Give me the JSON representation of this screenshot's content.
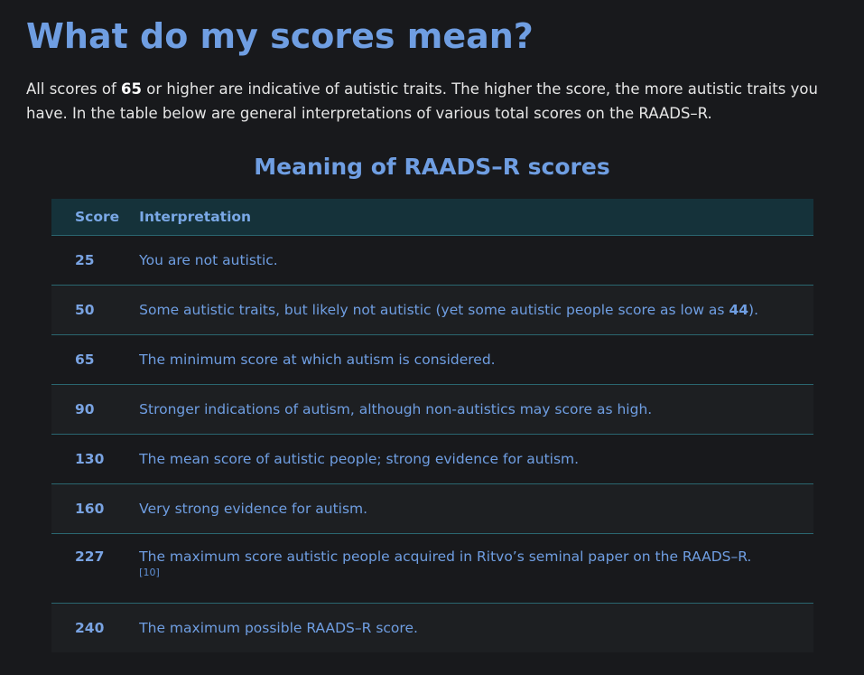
{
  "heading": "What do my scores mean?",
  "intro": {
    "before": "All scores of ",
    "score": "65",
    "after": " or higher are indicative of autistic traits. The higher the score, the more autistic traits you have. In the table below are general interpretations of various total scores on the RAADS–R."
  },
  "table": {
    "caption": "Meaning of RAADS–R scores",
    "headers": {
      "score": "Score",
      "interpretation": "Interpretation"
    },
    "rows": [
      {
        "score": "25",
        "text": "You are not autistic."
      },
      {
        "score": "50",
        "text_before": "Some autistic traits, but likely not autistic (yet some autistic people score as low as ",
        "bold": "44",
        "text_after": ")."
      },
      {
        "score": "65",
        "text": "The minimum score at which autism is considered."
      },
      {
        "score": "90",
        "text": "Stronger indications of autism, although non-autistics may score as high."
      },
      {
        "score": "130",
        "text": "The mean score of autistic people; strong evidence for autism."
      },
      {
        "score": "160",
        "text": "Very strong evidence for autism."
      },
      {
        "score": "227",
        "text": "The maximum score autistic people acquired in Ritvo’s seminal paper on the RAADS–R.",
        "citation": "[10]"
      },
      {
        "score": "240",
        "text": "The maximum possible RAADS–R score."
      }
    ]
  }
}
